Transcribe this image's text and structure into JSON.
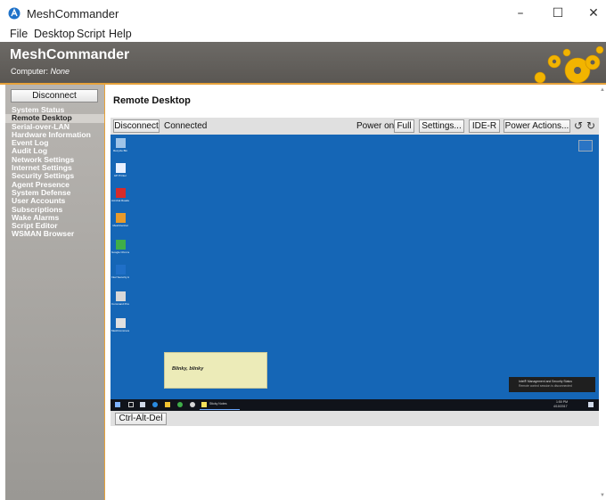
{
  "window": {
    "title": "MeshCommander",
    "controls": {
      "minimize": "–",
      "maximize": "☐",
      "close": "✕"
    }
  },
  "menu": [
    "File",
    "Desktop",
    "Script",
    "Help"
  ],
  "banner": {
    "title": "MeshCommander",
    "computer_label": "Computer:",
    "computer_value": "None"
  },
  "sidebar": {
    "disconnect": "Disconnect",
    "items": [
      {
        "label": "System Status",
        "active": false
      },
      {
        "label": "Remote Desktop",
        "active": true
      },
      {
        "label": "Serial-over-LAN",
        "active": false
      },
      {
        "label": "Hardware Information",
        "active": false
      },
      {
        "label": "Event Log",
        "active": false
      },
      {
        "label": "Audit Log",
        "active": false
      },
      {
        "label": "Network Settings",
        "active": false
      },
      {
        "label": "Internet Settings",
        "active": false
      },
      {
        "label": "Security Settings",
        "active": false
      },
      {
        "label": "Agent Presence",
        "active": false
      },
      {
        "label": "System Defense",
        "active": false
      },
      {
        "label": "User Accounts",
        "active": false
      },
      {
        "label": "Subscriptions",
        "active": false
      },
      {
        "label": "Wake Alarms",
        "active": false
      },
      {
        "label": "Script Editor",
        "active": false
      },
      {
        "label": "WSMAN Browser",
        "active": false
      }
    ]
  },
  "main": {
    "title": "Remote Desktop",
    "toolbar": {
      "disconnect": "Disconnect",
      "status": "Connected",
      "power_label": "Power on",
      "full": "Full",
      "settings": "Settings...",
      "ider": "IDE-R",
      "power_actions": "Power Actions...",
      "rotate_left": "↺",
      "rotate_right": "↻"
    },
    "remote_desktop": {
      "icons": [
        {
          "label": "Recycle Bin",
          "icon": "recycle-bin-icon",
          "color": "#9fc4e8"
        },
        {
          "label": "HP Printer",
          "icon": "printer-icon",
          "color": "#e8f0ff"
        },
        {
          "label": "Acrobat Reader DC",
          "icon": "acrobat-icon",
          "color": "#d62b2b"
        },
        {
          "label": "MeshCentral",
          "icon": "mesh-icon",
          "color": "#e79a2b"
        },
        {
          "label": "Google Chrome",
          "icon": "chrome-icon",
          "color": "#3fae49"
        },
        {
          "label": "Intel Security Assist",
          "icon": "intel-icon",
          "color": "#1f6fc7"
        },
        {
          "label": "Command Prompt",
          "icon": "cmd-icon",
          "color": "#d8d8d8"
        },
        {
          "label": "MeshCommander",
          "icon": "meshcommander-icon",
          "color": "#e0e0e0"
        }
      ],
      "sticky_note": "Blinky, blinky",
      "toast_title": "Intel® Management and Security Status",
      "toast_message": "Remote control session is disconnected",
      "taskbar_app": "Sticky Notes",
      "clock": "1:50 PM",
      "date": "4/10/2017"
    },
    "ctrl_alt_del": "Ctrl-Alt-Del"
  },
  "colors": {
    "accent": "#e7a23a",
    "desktop": "#1566b6",
    "sidebar": "#a8a5a1",
    "banner": "#5f5c58"
  }
}
